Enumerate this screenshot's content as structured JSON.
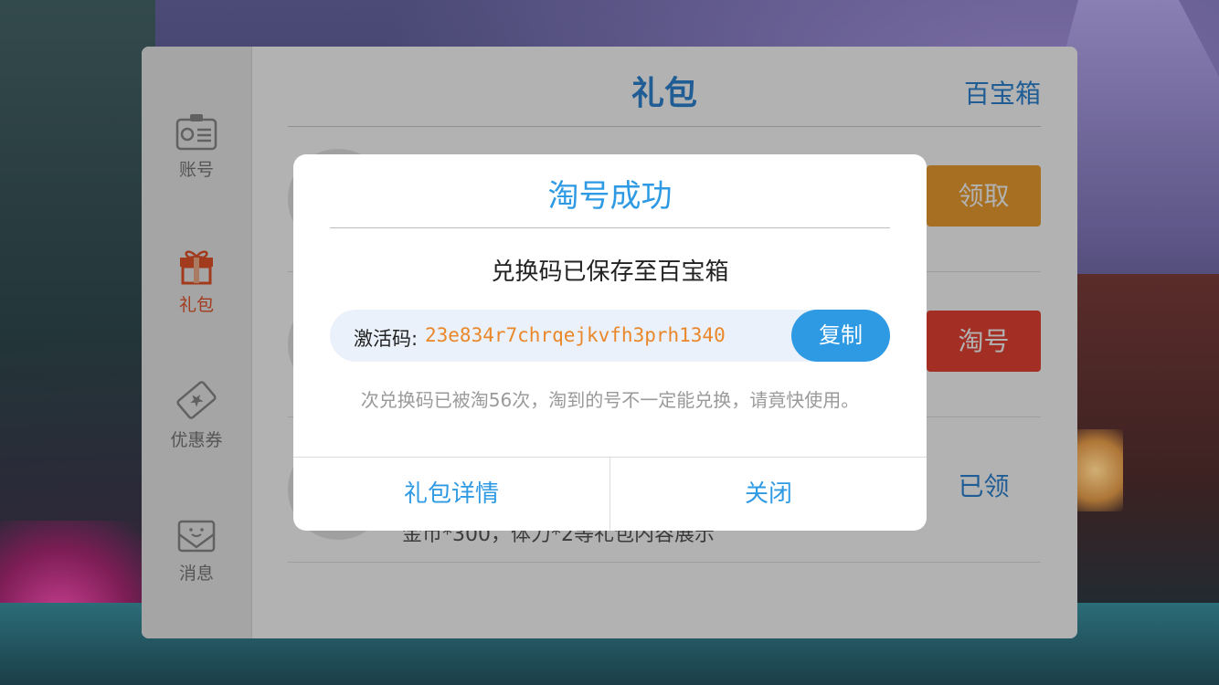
{
  "sidebar": {
    "items": [
      {
        "label": "账号",
        "icon": "id-card-icon"
      },
      {
        "label": "礼包",
        "icon": "gift-icon",
        "active": true
      },
      {
        "label": "优惠券",
        "icon": "coupon-icon"
      },
      {
        "label": "消息",
        "icon": "message-icon"
      }
    ]
  },
  "header": {
    "title": "礼包",
    "right_label": "百宝箱"
  },
  "rows": [
    {
      "button": "领取",
      "button_color": "#f0a032"
    },
    {
      "button": "淘号",
      "button_color": "#e84234"
    },
    {
      "button": "已领",
      "desc": "金币*300，体力*2等礼包内容展示"
    }
  ],
  "modal": {
    "title": "淘号成功",
    "message": "兑换码已保存至百宝箱",
    "code_label": "激活码:",
    "code_value": "23e834r7chrqejkvfh3prh1340",
    "copy_label": "复制",
    "note": "次兑换码已被淘56次，淘到的号不一定能兑换，请竟快使用。",
    "left_button": "礼包详情",
    "right_button": "关闭"
  },
  "colors": {
    "accent": "#2e9ae3",
    "active_side": "#e8552c",
    "code_text": "#e9872a"
  }
}
